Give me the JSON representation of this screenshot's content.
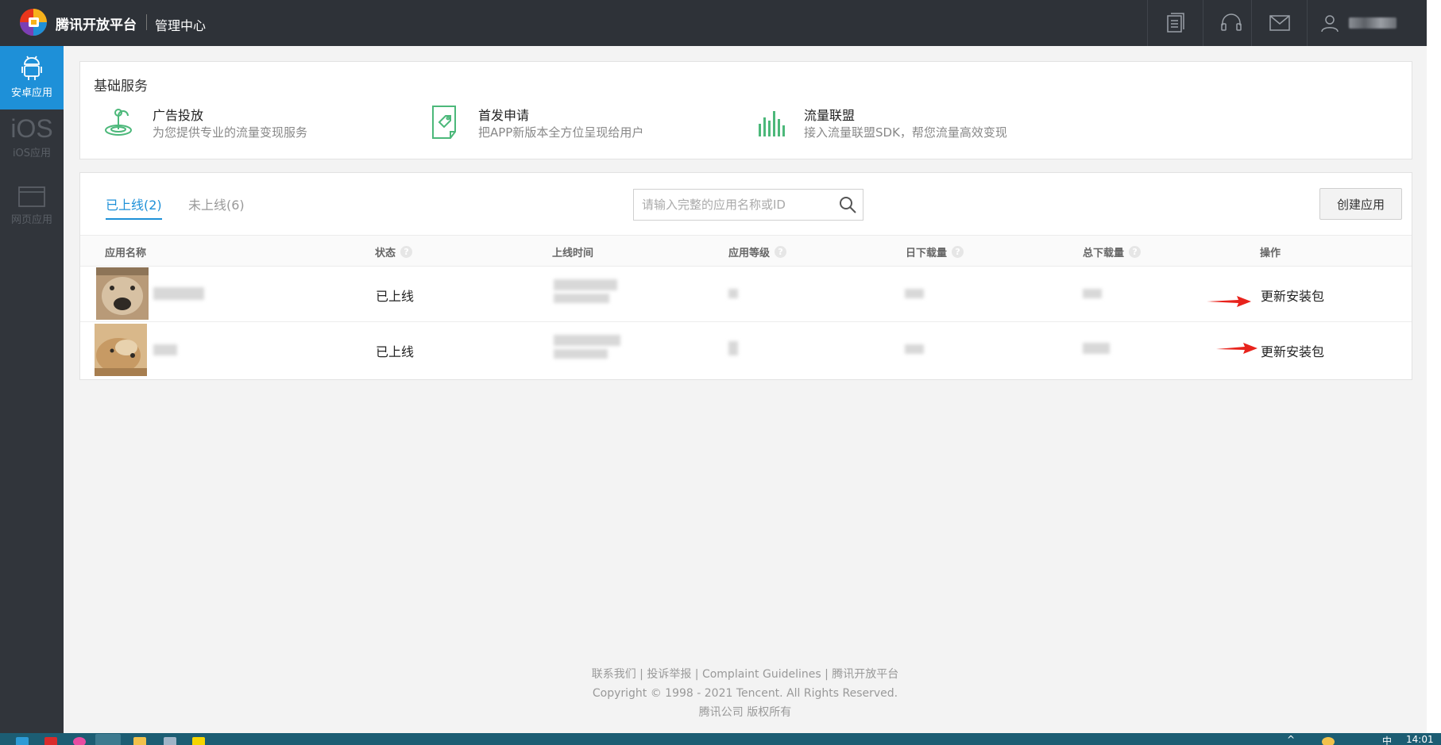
{
  "header": {
    "brand": "腾讯开放平台",
    "subtitle": "管理中心"
  },
  "sidebar": {
    "items": [
      {
        "label": "安卓应用"
      },
      {
        "label": "iOS应用",
        "glyph": "iOS"
      },
      {
        "label": "网页应用"
      }
    ]
  },
  "services": {
    "title": "基础服务",
    "items": [
      {
        "name": "广告投放",
        "desc": "为您提供专业的流量变现服务"
      },
      {
        "name": "首发申请",
        "desc": "把APP新版本全方位呈现给用户"
      },
      {
        "name": "流量联盟",
        "desc": "接入流量联盟SDK，帮您流量高效变现"
      }
    ]
  },
  "apps": {
    "tabs": [
      {
        "label": "已上线(2)"
      },
      {
        "label": "未上线(6)"
      }
    ],
    "search": {
      "placeholder": "请输入完整的应用名称或ID"
    },
    "create_label": "创建应用",
    "columns": [
      "应用名称",
      "状态",
      "上线时间",
      "应用等级",
      "日下载量",
      "总下载量",
      "操作"
    ],
    "rows": [
      {
        "status": "已上线",
        "action": "更新安装包"
      },
      {
        "status": "已上线",
        "action": "更新安装包"
      }
    ]
  },
  "footer": {
    "links": [
      "联系我们",
      "投诉举报",
      "Complaint Guidelines",
      "腾讯开放平台"
    ],
    "copyright": "Copyright © 1998 - 2021 Tencent. All Rights Reserved.",
    "owner": "腾讯公司 版权所有"
  },
  "taskbar": {
    "ime": "中",
    "time": "14:01"
  },
  "colors": {
    "topbar": "#2e3238",
    "sidebar": "#31353b",
    "accent": "#1e90d8",
    "service_icon": "#4cb87a",
    "arrow": "#e8231c"
  }
}
